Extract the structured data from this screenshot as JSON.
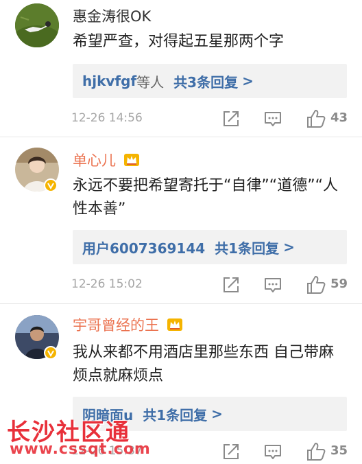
{
  "colors": {
    "vip_name": "#eb7350",
    "link_blue": "#3f6ea8",
    "reply_bg": "#f2f2f2",
    "meta_gray": "#a6a6a6",
    "watermark_red": "#e8303a"
  },
  "comments": [
    {
      "username": "惠金涛很OK",
      "vip": false,
      "verified": false,
      "text": "希望严查，对得起五星那两个字",
      "reply_user": "hjkvfgf",
      "reply_suffix": "等人",
      "reply_count": "共3条回复",
      "reply_arrow": ">",
      "time": "12-26 14:56",
      "likes": "43",
      "icons": {
        "share": "share-icon",
        "comment": "comment-icon",
        "like": "thumbs-up-icon"
      }
    },
    {
      "username": "单心儿",
      "vip": true,
      "verified": true,
      "text": "永远不要把希望寄托于“自律”“道德”“人性本善”",
      "reply_user": "用户6007369144",
      "reply_suffix": "",
      "reply_count": "共1条回复",
      "reply_arrow": ">",
      "time": "12-26 15:02",
      "likes": "59",
      "icons": {
        "share": "share-icon",
        "comment": "comment-icon",
        "like": "thumbs-up-icon"
      }
    },
    {
      "username": "宇哥曾经的王",
      "vip": true,
      "verified": true,
      "text": "我从来都不用酒店里那些东西 自己带麻烦点就麻烦点",
      "reply_user": "阴暗面u",
      "reply_suffix": "",
      "reply_count": "共1条回复",
      "reply_arrow": ">",
      "time": "12-26 15:37",
      "likes": "35",
      "icons": {
        "share": "share-icon",
        "comment": "comment-icon",
        "like": "thumbs-up-icon"
      }
    }
  ],
  "watermark": {
    "title": "长沙社区通",
    "url": "www.cssqt.com"
  }
}
